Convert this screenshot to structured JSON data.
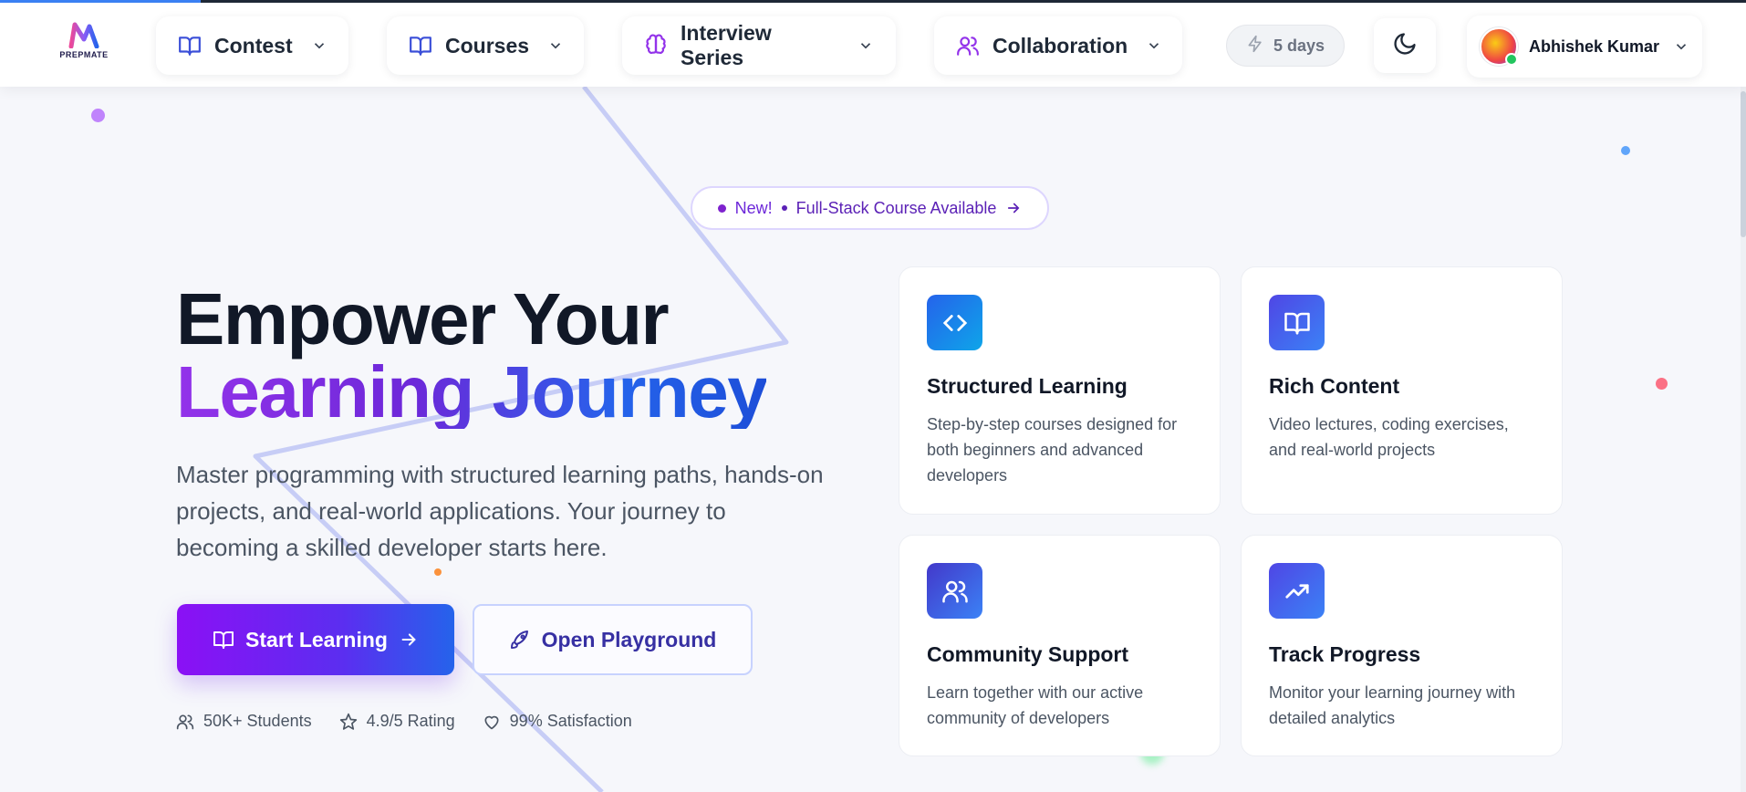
{
  "app": {
    "logo_text": "PREPMATE"
  },
  "nav": {
    "items": [
      {
        "label": "Contest",
        "icon": "book-open-icon"
      },
      {
        "label": "Courses",
        "icon": "book-open-icon"
      },
      {
        "label": "Interview Series",
        "icon": "brain-icon"
      },
      {
        "label": "Collaboration",
        "icon": "users-icon"
      }
    ],
    "streak_label": "5 days",
    "user_name": "Abhishek Kumar"
  },
  "colors": {
    "brand_purple": "#8b10f5",
    "brand_blue": "#2563eb",
    "nav_icon_blue": "#3b4fd8",
    "nav_icon_purple": "#9333ea"
  },
  "hero": {
    "badge_new": "New!",
    "badge_text": "Full-Stack Course Available",
    "title_line1": "Empower Your",
    "title_line2": "Learning Journey",
    "description": "Master programming with structured learning paths, hands-on projects, and real-world applications. Your journey to becoming a skilled developer starts here.",
    "primary_button": "Start Learning",
    "secondary_button": "Open Playground",
    "stats": [
      {
        "label": "50K+ Students",
        "icon": "users-icon"
      },
      {
        "label": "4.9/5 Rating",
        "icon": "star-icon"
      },
      {
        "label": "99% Satisfaction",
        "icon": "heart-icon"
      }
    ]
  },
  "features": [
    {
      "title": "Structured Learning",
      "description": "Step-by-step courses designed for both beginners and advanced developers",
      "icon": "code-icon"
    },
    {
      "title": "Rich Content",
      "description": "Video lectures, coding exercises, and real-world projects",
      "icon": "book-open-icon"
    },
    {
      "title": "Community Support",
      "description": "Learn together with our active community of developers",
      "icon": "users-icon"
    },
    {
      "title": "Track Progress",
      "description": "Monitor your learning journey with detailed analytics",
      "icon": "trending-up-icon"
    }
  ]
}
